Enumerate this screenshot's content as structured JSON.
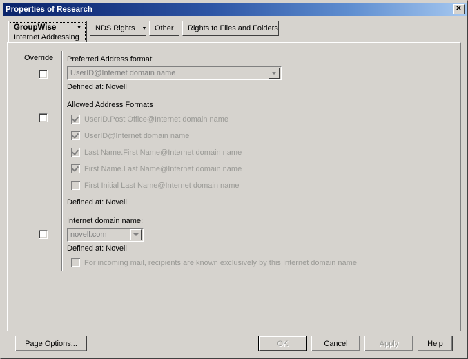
{
  "window": {
    "title": "Properties of Research",
    "close_icon": "close-icon",
    "close_glyph": "✕"
  },
  "tabs": [
    {
      "label": "GroupWise",
      "sublabel": "Internet Addressing",
      "has_dropdown": true,
      "active": true
    },
    {
      "label": "NDS Rights",
      "has_dropdown": true,
      "active": false
    },
    {
      "label": "Other",
      "has_dropdown": false,
      "active": false
    },
    {
      "label": "Rights to Files and Folders",
      "has_dropdown": false,
      "active": false
    }
  ],
  "content": {
    "override_column_label": "Override",
    "preferred_address_format": {
      "label": "Preferred Address format:",
      "value": "UserID@Internet domain name",
      "defined_at": "Defined at:  Novell",
      "override_checked": false,
      "disabled": true
    },
    "allowed_address_formats": {
      "label": "Allowed Address Formats",
      "override_checked": false,
      "defined_at": "Defined at:  Novell",
      "items": [
        {
          "label": "UserID.Post Office@Internet domain name",
          "checked": true
        },
        {
          "label": "UserID@Internet domain name",
          "checked": true
        },
        {
          "label": "Last Name.First Name@Internet domain name",
          "checked": true
        },
        {
          "label": "First Name.Last Name@Internet domain name",
          "checked": true
        },
        {
          "label": "First Initial Last Name@Internet domain name",
          "checked": false
        }
      ]
    },
    "internet_domain_name": {
      "label": "Internet domain name:",
      "value": "novell.com",
      "defined_at": "Defined at:  Novell",
      "override_checked": false,
      "disabled": true,
      "exclusive_option": {
        "label": "For incoming mail, recipients are known exclusively by this Internet domain name",
        "checked": false
      }
    }
  },
  "buttons": {
    "page_options": {
      "accel": "P",
      "rest": "age Options...",
      "enabled": true
    },
    "ok": {
      "label": "OK",
      "enabled": false,
      "is_default": true
    },
    "cancel": {
      "label": "Cancel",
      "enabled": true
    },
    "apply": {
      "label": "Apply",
      "enabled": false
    },
    "help": {
      "accel": "H",
      "rest": "elp",
      "enabled": true
    }
  },
  "colors": {
    "face": "#d6d3ce",
    "titlebar_dark": "#0a246a",
    "titlebar_light": "#a6c8f0",
    "disabled_text": "#9a9a96"
  }
}
